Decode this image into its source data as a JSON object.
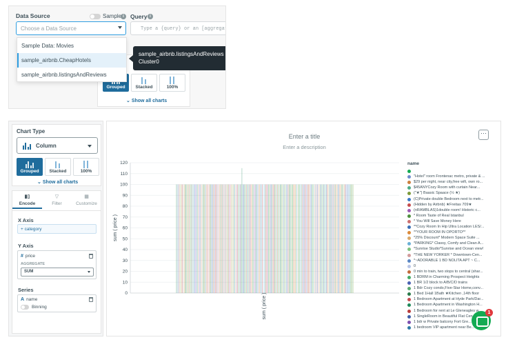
{
  "data_source_panel": {
    "label": "Data Source",
    "placeholder": "Choose a Data Source",
    "sample_label": "Sample",
    "query_label": "Query",
    "query_placeholder": "Type a {query} or an [aggregation",
    "menu_items": [
      "Sample Data: Movies",
      "sample_airbnb.CheapHotels",
      "sample_airbnb.listingsAndReviews"
    ],
    "hovered_item": "sample_airbnb.CheapHotels",
    "tooltip_line1": "sample_airbnb.listingsAndReviews",
    "tooltip_line2": "Cluster0",
    "partial_text": "ar",
    "chart_types": [
      "Grouped",
      "Stacked",
      "100%"
    ],
    "show_all": "Show all charts"
  },
  "chart_builder": {
    "chart_type_label": "Chart Type",
    "chart_type_value": "Column",
    "chart_types": [
      "Grouped",
      "Stacked",
      "100%"
    ],
    "show_all": "Show all charts",
    "tabs": [
      {
        "label": "Encode",
        "icon": "encode-icon"
      },
      {
        "label": "Filter",
        "icon": "filter-icon"
      },
      {
        "label": "Customize",
        "icon": "customize-icon"
      }
    ],
    "x_axis_label": "X Axis",
    "x_placeholder": "+ category",
    "y_axis_label": "Y Axis",
    "y_field": "price",
    "y_field_type": "#",
    "aggregate_label": "AGGREGATE",
    "aggregate_value": "SUM",
    "series_label": "Series",
    "series_field": "name",
    "series_field_type": "A",
    "binning_label": "Binning"
  },
  "chart": {
    "title_placeholder": "Enter a title",
    "description_placeholder": "Enter a description",
    "more_button": "···",
    "legend_title": "name",
    "legend_items": [
      "",
      "\"Hotel\" room Frontenac metro, private & ...",
      "$29 per night, near city,free wifi, own ro...",
      "$45ANYCozy Room with curtain Near...",
      "(\"★\") Baasic Spaace (½ ★)",
      "(C)Private double Bedroom next to metr...",
      "(Hidden by Airbnb) ★Freitas 709★",
      "(nRAMBLAS)1double room! Historic c...",
      "* Room Taste of Real Istanbul",
      "* You Will Save Money Here",
      "**Cozy Room In Hip Ultra Location LES/...",
      "**YOUR ROOM IN OPORTO**",
      "*25% Discount* Modern Space Suite ...",
      "*PARKING* Classy, Comfy and Clean A...",
      "*Sunrise Studio*Sunrise and Ocean view!",
      "*THE NEW YORKER * Downtown-Cen...",
      "*~ADORABLE 1 BD NOLITA APT ~ C...",
      "0",
      "0 min to train, two stops to central (shar...",
      "1 BDRM in Charming Prospect Heights",
      "1 BR 1/2 block to A/B/C/D trains",
      "1 Bdr Cozy condo,Five-Star Home,conv...",
      "1 Bed 1Hall 1Bath ★Kitchen ,14th floor",
      "1 Bedroom Apartment at Hyde Park/Dar...",
      "1 Bedroom Apartment in Washington H...",
      "1 Bedroom for rent at Le Gleneagles w...",
      "1 SingleRoom in Beautiful Flat Cen...",
      "1 bdr w Private balcony Fort Gre...",
      "1 bedroom VIP apartment near Be..."
    ],
    "legend_colors": [
      "#13aa52",
      "#6d8ccc",
      "#cc7f3d",
      "#4cab86",
      "#7c9a3a",
      "#3a79c8",
      "#c64d4d",
      "#9d59b5",
      "#4e8f3e",
      "#cc6f6f",
      "#3b6fb5",
      "#dc8a3a",
      "#d9a86a",
      "#6ab0d6",
      "#7fc37d",
      "#d29c9c",
      "#5a86c4",
      "#b9c5e6",
      "#c36a3b",
      "#44aa66",
      "#4b61b3",
      "#59a86f",
      "#2a7a4a",
      "#c4494f",
      "#1f8a5a",
      "#b83c3c",
      "#3f5ea8",
      "#7d4fb0",
      "#2c7aa5"
    ],
    "chart_data": {
      "type": "bar",
      "ylabel": "sum ( price )",
      "xlabel": "",
      "ylim": [
        0,
        120
      ],
      "yticks": [
        0,
        10,
        20,
        30,
        40,
        50,
        60,
        70,
        80,
        90,
        100,
        110,
        120
      ],
      "x_category_label": "sum ( price )",
      "bar_count": 200,
      "typical_value": 100,
      "peak_value": 115
    }
  },
  "chat": {
    "badge": "1"
  }
}
